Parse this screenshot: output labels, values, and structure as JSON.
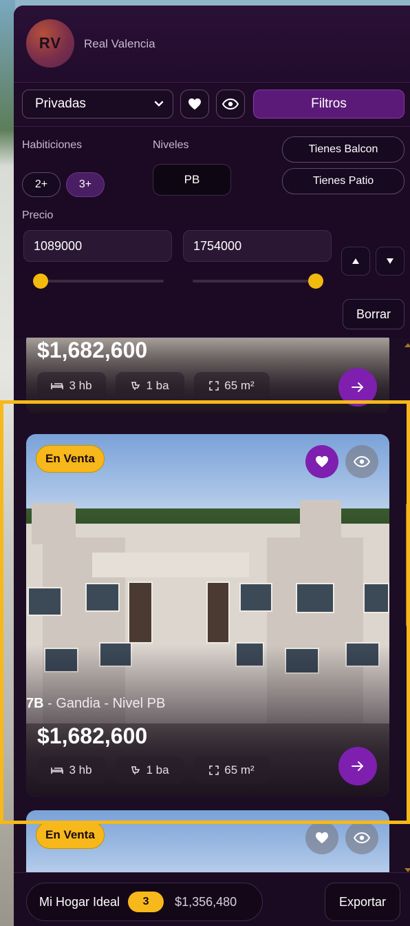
{
  "header": {
    "avatar_initials": "RV",
    "brand_name": "Real Valencia"
  },
  "toolbar": {
    "select_value": "Privadas",
    "favorites_icon": "heart-icon",
    "view_icon": "eye-icon",
    "filters_label": "Filtros"
  },
  "filters": {
    "rooms_label": "Habiticiones",
    "rooms_options": [
      "2+",
      "3+"
    ],
    "rooms_selected": "3+",
    "levels_label": "Niveles",
    "level_value": "PB",
    "balcony_label": "Tienes Balcon",
    "patio_label": "Tienes Patio",
    "price_label": "Precio",
    "price_min": "1089000",
    "price_max": "1754000",
    "sort_up_icon": "triangle-up-icon",
    "sort_down_icon": "triangle-down-icon",
    "clear_label": "Borrar"
  },
  "listings": [
    {
      "price": "$1,682,600",
      "beds": "3 hb",
      "baths": "1 ba",
      "area": "65 m²"
    },
    {
      "status": "En Venta",
      "unit": "7B",
      "location": " - Gandia - Nivel PB",
      "price": "$1,682,600",
      "beds": "3 hb",
      "baths": "1 ba",
      "area": "65 m²",
      "favorited": true
    },
    {
      "status": "En Venta",
      "favorited": false
    }
  ],
  "footer": {
    "summary_label": "Mi Hogar Ideal",
    "count": "3",
    "total": "$1,356,480",
    "export_label": "Exportar"
  },
  "colors": {
    "accent": "#7e1fb0",
    "badge": "#f6b81a",
    "panel": "#1c0c24"
  }
}
